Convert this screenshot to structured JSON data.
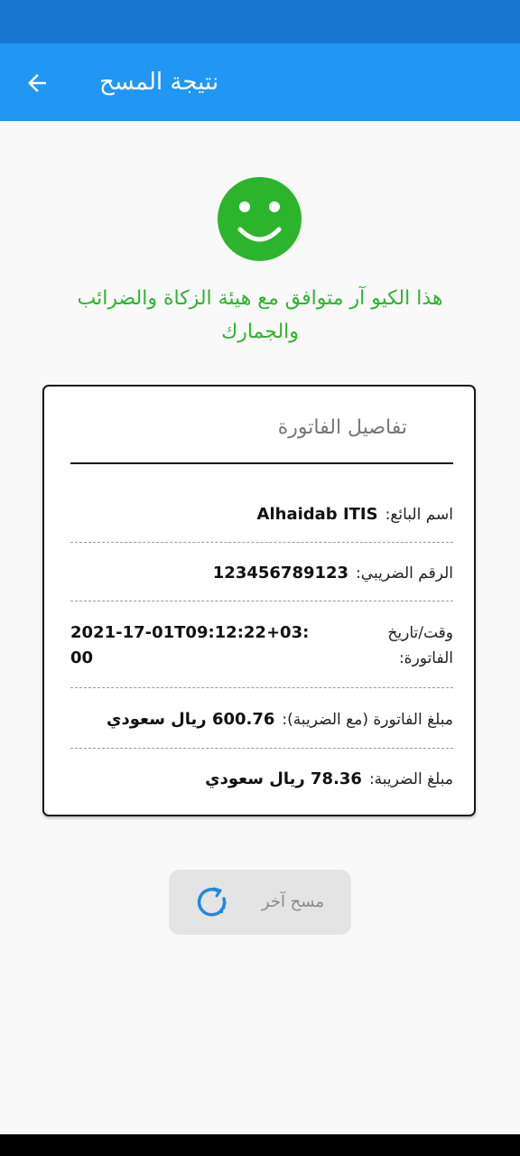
{
  "app_bar": {
    "title": "نتيجة المسح",
    "back_icon": "arrow-left-icon"
  },
  "result": {
    "icon": "smiley-icon",
    "message": "هذا الكيو آر متوافق مع هيئة الزكاة والضرائب والجمارك",
    "color": "#2cb52c"
  },
  "invoice": {
    "title": "تفاصيل الفاتورة",
    "seller_label": "اسم البائع:",
    "seller_value": "Alhaidab ITIS",
    "tax_number_label": "الرقم الضريبي:",
    "tax_number_value": "123456789123",
    "datetime_label": "وقت/تاريخ الفاتورة:",
    "datetime_value": "2021-17-01T09:12:22+03:00",
    "total_label": "مبلغ الفاتورة (مع الضريبة):",
    "total_value": "600.76 ريال سعودي",
    "vat_label": "مبلغ الضريبة:",
    "vat_value": "78.36 ريال سعودي"
  },
  "actions": {
    "scan_again_label": "مسح آخر",
    "scan_again_icon": "refresh-spinner-icon"
  },
  "colors": {
    "status_bar": "#1976d2",
    "app_bar": "#2196f3",
    "success": "#2cb52c"
  }
}
